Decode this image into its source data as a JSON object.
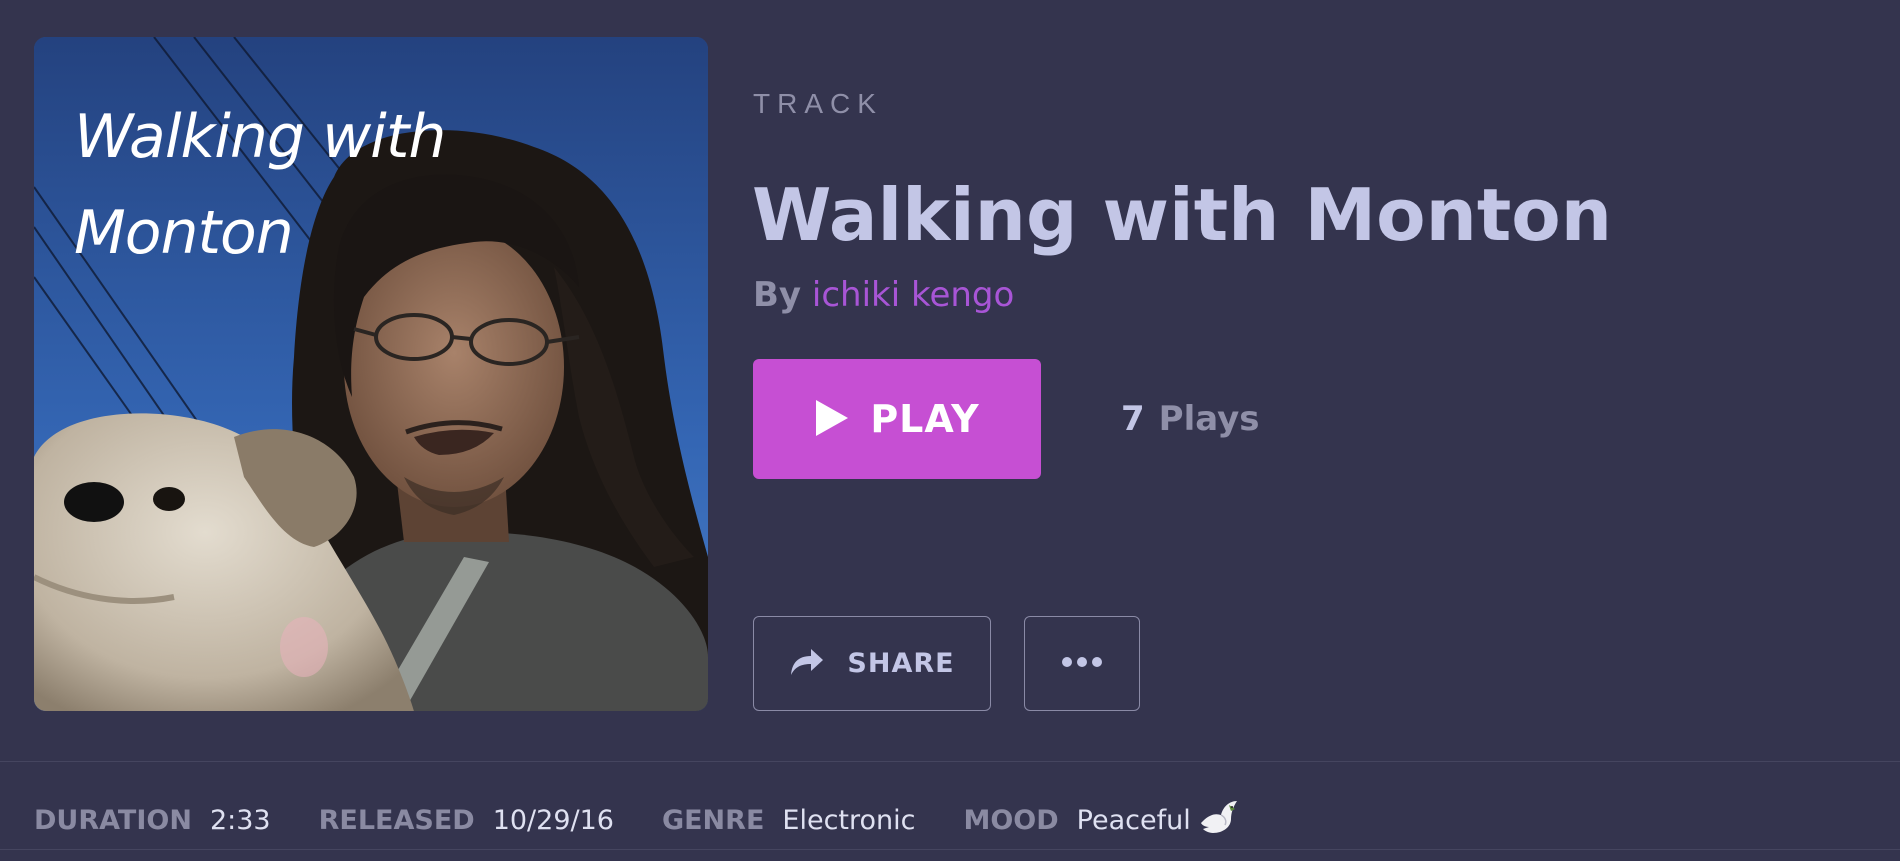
{
  "artwork": {
    "title_text": "Walking with Monton",
    "subject": "man-with-dog-photo"
  },
  "header": {
    "type_label": "TRACK",
    "title": "Walking with Monton",
    "by_label": "By",
    "artist": "ichiki kengo"
  },
  "actions": {
    "play_label": "PLAY",
    "plays_count": "7",
    "plays_label": "Plays",
    "share_label": "SHARE",
    "more_icon": "ellipsis-icon"
  },
  "metadata": {
    "duration_label": "DURATION",
    "duration_value": "2:33",
    "released_label": "RELEASED",
    "released_value": "10/29/16",
    "genre_label": "GENRE",
    "genre_value": "Electronic",
    "mood_label": "MOOD",
    "mood_value": "Peaceful",
    "mood_icon": "dove-icon"
  },
  "colors": {
    "background": "#34344e",
    "accent": "#c64fd3",
    "artist_link": "#a855d6",
    "title_text": "#c3c6e6",
    "muted_text": "#8f8fa8"
  }
}
